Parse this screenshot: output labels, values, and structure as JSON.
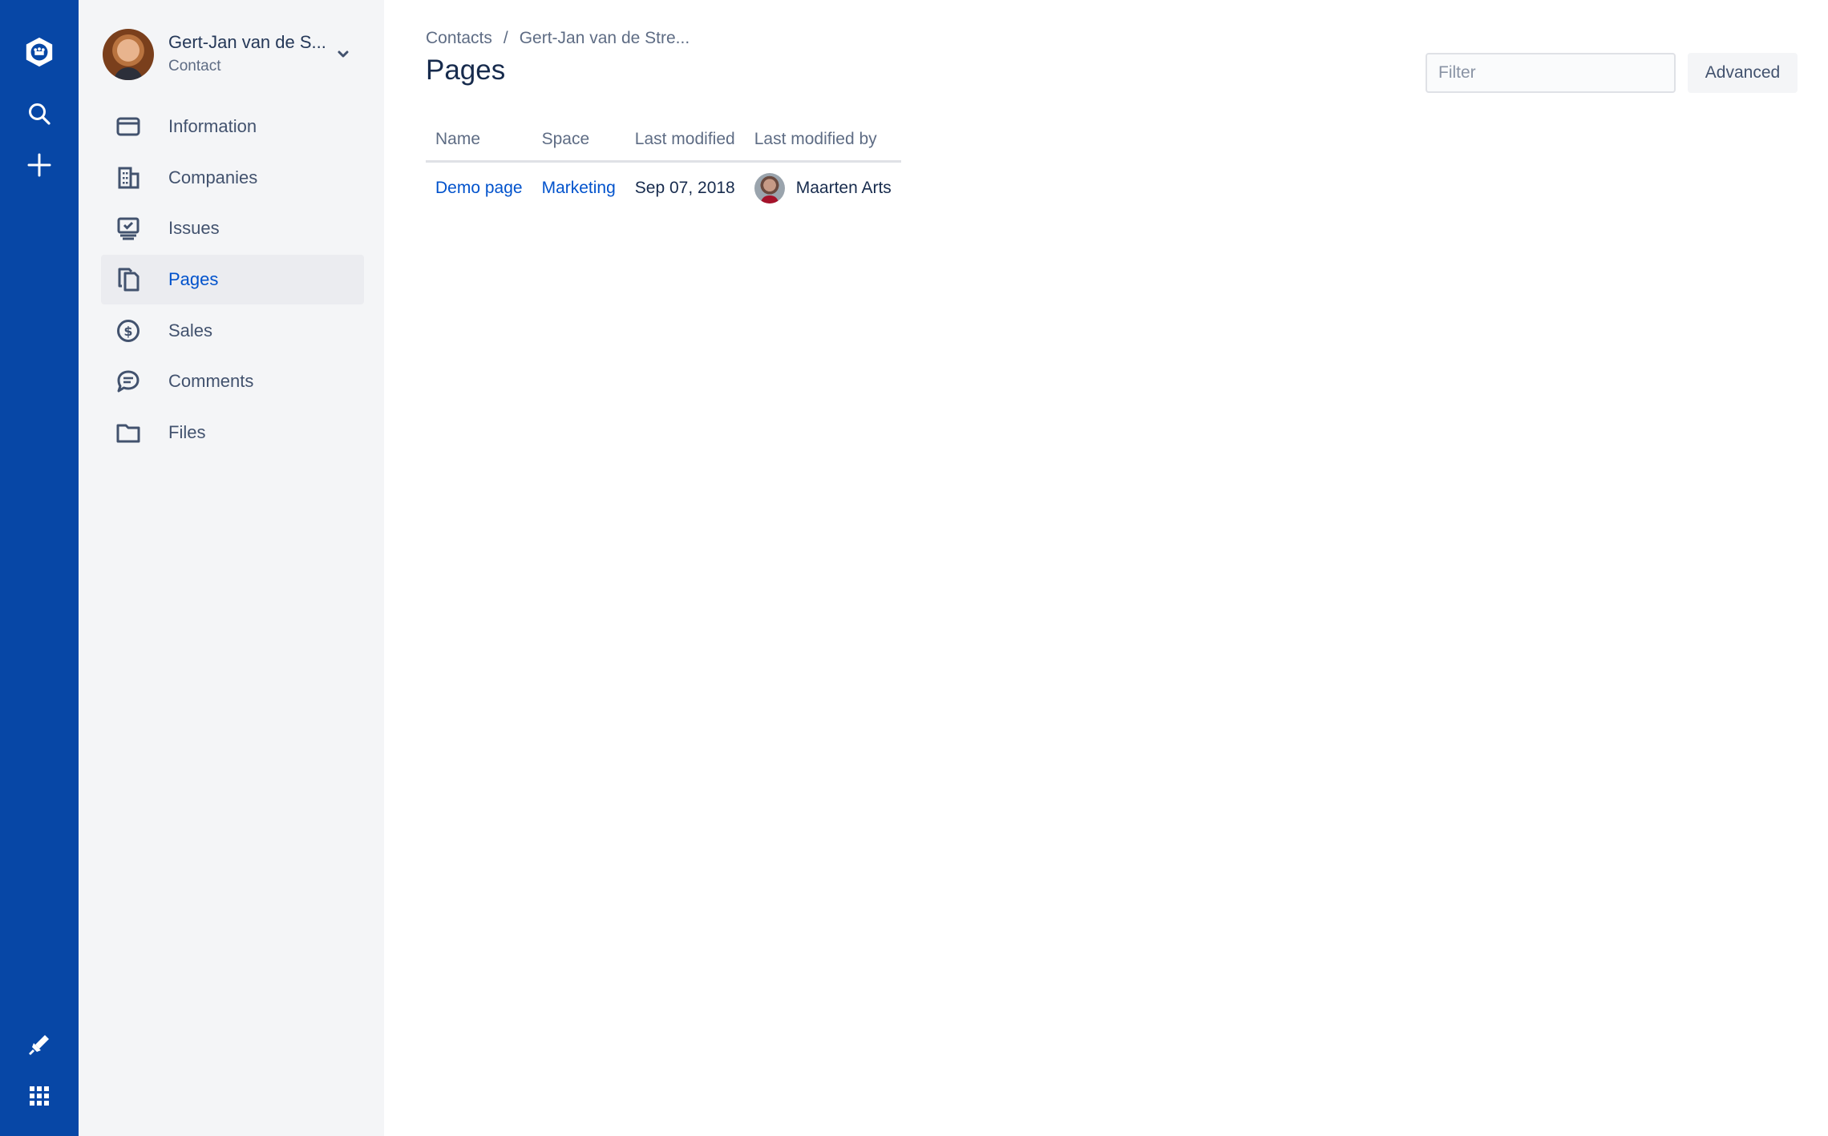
{
  "global_nav": {
    "icons": [
      "app-logo-icon",
      "search-icon",
      "plus-icon",
      "notification-icon",
      "app-switcher-icon"
    ],
    "color": "#0747a6"
  },
  "sidebar": {
    "name": "Gert-Jan van de S...",
    "type": "Contact",
    "items": [
      {
        "label": "Information",
        "icon": "card-icon"
      },
      {
        "label": "Companies",
        "icon": "building-icon"
      },
      {
        "label": "Issues",
        "icon": "issues-icon"
      },
      {
        "label": "Pages",
        "icon": "pages-icon",
        "active": true
      },
      {
        "label": "Sales",
        "icon": "dollar-icon"
      },
      {
        "label": "Comments",
        "icon": "comment-icon"
      },
      {
        "label": "Files",
        "icon": "folder-icon"
      }
    ]
  },
  "main": {
    "breadcrumb": [
      "Contacts",
      "/",
      "Gert-Jan van de Stre..."
    ],
    "title": "Pages",
    "filter": {
      "placeholder": "Filter",
      "value": ""
    },
    "advanced_label": "Advanced",
    "table": {
      "headers": [
        "Name",
        "Space",
        "Last modified",
        "Last modified by"
      ],
      "rows": [
        {
          "name": "Demo page",
          "space": "Marketing",
          "modified": "Sep 07, 2018",
          "modified_by": "Maarten Arts"
        }
      ]
    }
  },
  "colors": {
    "link": "#0052cc",
    "sidebar_bg": "#f4f5f7",
    "active_bg": "#ebecf0"
  }
}
